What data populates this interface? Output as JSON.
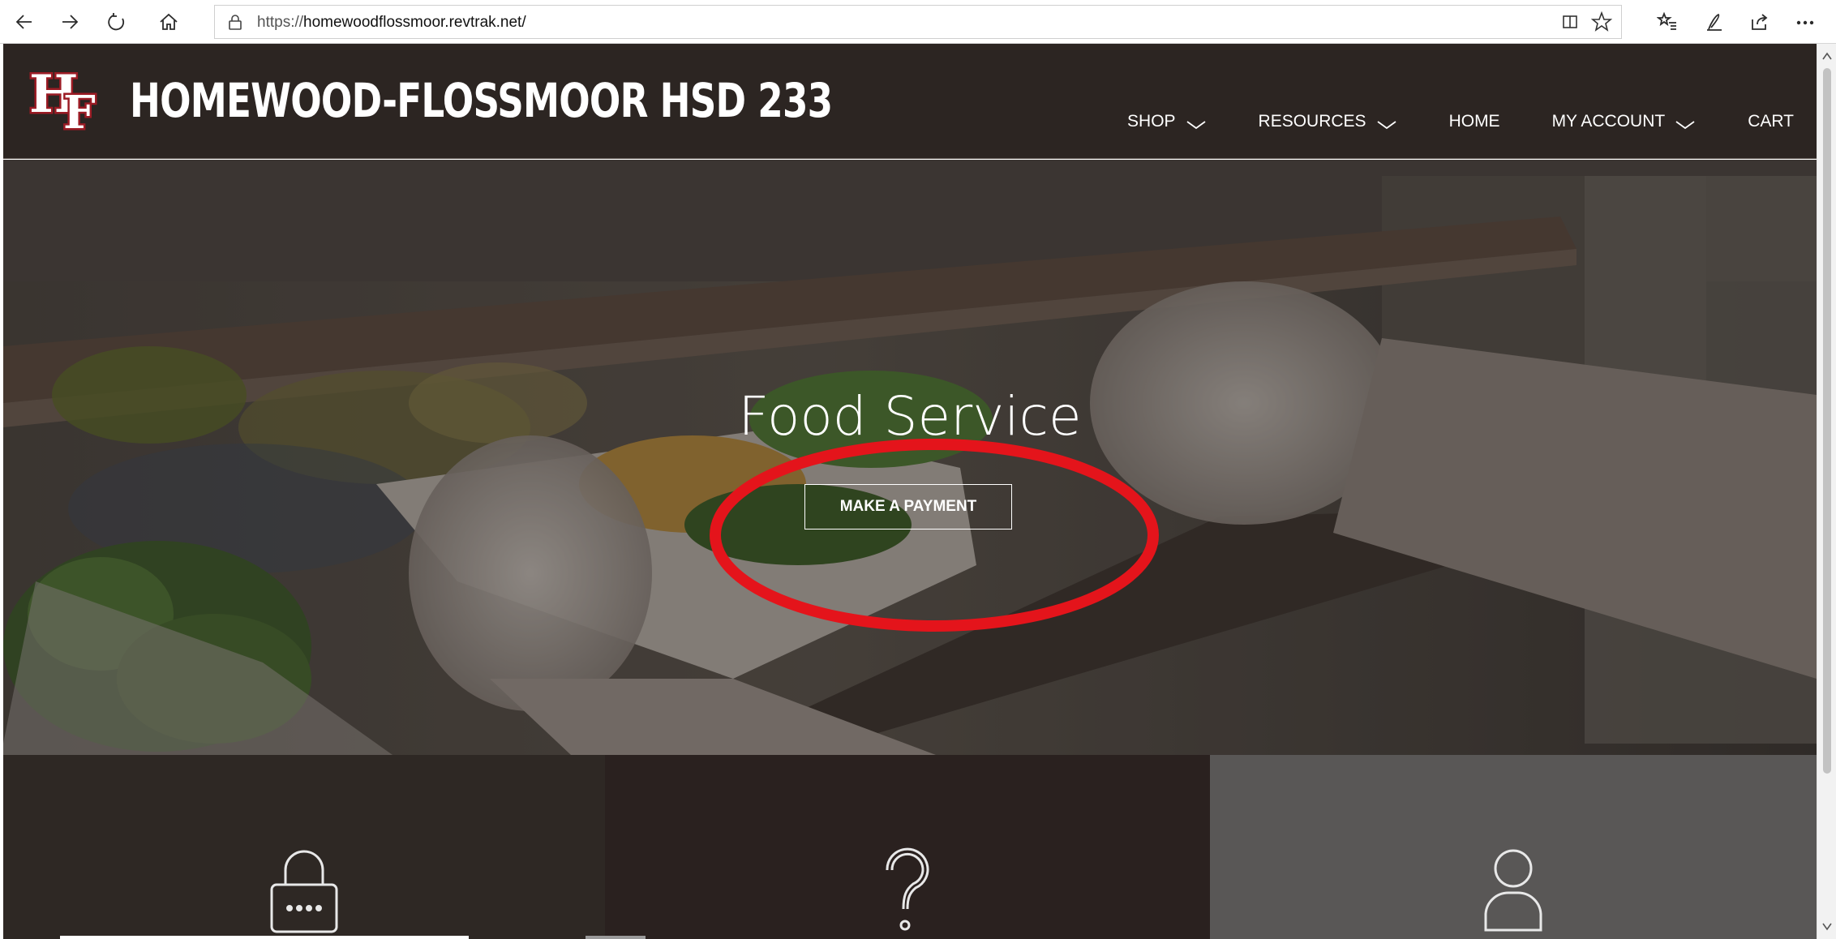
{
  "browser": {
    "url_prefix": "https://",
    "url_host": "homewoodflossmoor.revtrak.net/",
    "icons": {
      "back": "back-arrow-icon",
      "forward": "forward-arrow-icon",
      "refresh": "refresh-icon",
      "home": "home-icon",
      "lock": "lock-icon",
      "reading_view": "reading-view-icon",
      "favorite": "star-icon",
      "favorites_hub": "favorites-list-icon",
      "notes": "pen-icon",
      "share": "share-icon",
      "more": "more-dots-icon"
    }
  },
  "header": {
    "logo_letters": "HF",
    "title": "HOMEWOOD-FLOSSMOOR HSD 233",
    "nav": [
      {
        "label": "SHOP",
        "has_dropdown": true
      },
      {
        "label": "RESOURCES",
        "has_dropdown": true
      },
      {
        "label": "HOME",
        "has_dropdown": false
      },
      {
        "label": "MY ACCOUNT",
        "has_dropdown": true
      },
      {
        "label": "CART",
        "has_dropdown": false
      }
    ]
  },
  "hero": {
    "title": "Food Service",
    "button_label": "MAKE A PAYMENT",
    "annotation_color": "#e4141b"
  },
  "tiles": [
    {
      "icon": "padlock-icon"
    },
    {
      "icon": "question-mark-icon"
    },
    {
      "icon": "user-icon"
    }
  ],
  "colors": {
    "header_bg": "#2c2522",
    "tile_dark": "#2e2824",
    "tile_mid": "#2a211f",
    "tile_gray": "#595756",
    "logo_red": "#9b1b24"
  }
}
